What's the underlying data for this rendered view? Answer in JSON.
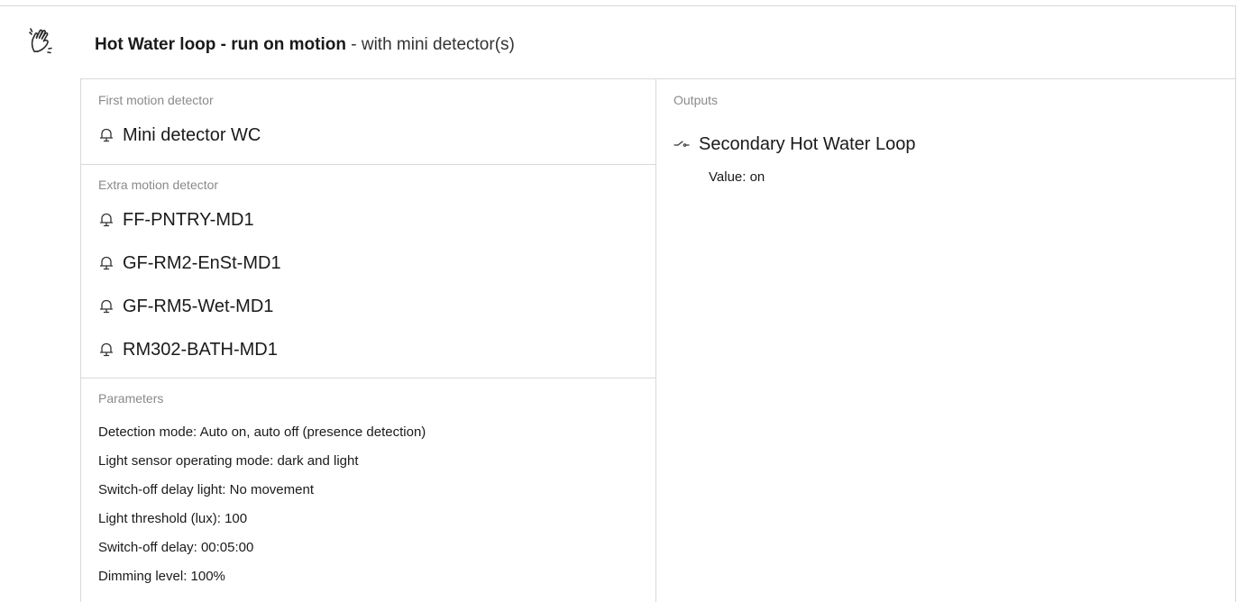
{
  "header": {
    "icon": "hand-wave-icon",
    "title": "Hot Water loop - run on motion",
    "subtitle": " - with mini detector(s)"
  },
  "first_detector": {
    "label": "First motion detector",
    "items": [
      "Mini detector WC"
    ]
  },
  "extra_detectors": {
    "label": "Extra motion detector",
    "items": [
      "FF-PNTRY-MD1",
      "GF-RM2-EnSt-MD1",
      "GF-RM5-Wet-MD1",
      "RM302-BATH-MD1"
    ]
  },
  "parameters": {
    "label": "Parameters",
    "items": [
      "Detection mode: Auto on, auto off (presence detection)",
      "Light sensor operating mode: dark and light",
      "Switch-off delay light: No movement",
      "Light threshold (lux): 100",
      "Switch-off delay: 00:05:00",
      "Dimming level: 100%"
    ]
  },
  "outputs": {
    "label": "Outputs",
    "items": [
      {
        "icon": "switch-icon",
        "name": "Secondary Hot Water Loop",
        "value": "Value: on"
      }
    ]
  }
}
